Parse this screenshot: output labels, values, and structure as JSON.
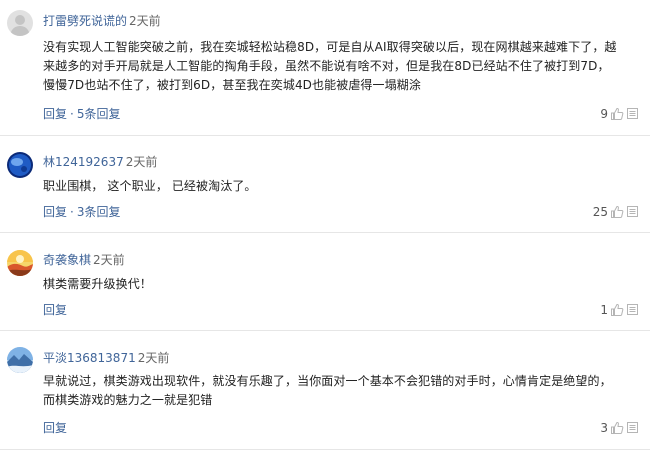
{
  "comments": [
    {
      "username": "打雷劈死说谎的",
      "time": "2天前",
      "text": "没有实现人工智能突破之前，我在奕城轻松站稳8D，可是自从AI取得突破以后，现在网棋越来越难下了，越来越多的对手开局就是人工智能的掏角手段，虽然不能说有啥不对，但是我在8D已经站不住了被打到7D，慢慢7D也站不住了，被打到6D，甚至我在奕城4D也能被虐得一塌糊涂",
      "reply_label": "回复",
      "separator": "·",
      "replies_label": "5条回复",
      "likes": "9",
      "avatar": "default-gray-avatar-icon"
    },
    {
      "username": "林124192637",
      "time": "2天前",
      "text": "职业围棋， 这个职业， 已经被淘汰了。",
      "reply_label": "回复",
      "separator": "·",
      "replies_label": "3条回复",
      "likes": "25",
      "avatar": "blue-planet-avatar-icon"
    },
    {
      "username": "奇袭象棋",
      "time": "2天前",
      "text": "棋类需要升级换代！",
      "reply_label": "回复",
      "likes": "1",
      "avatar": "sunset-landscape-avatar-icon"
    },
    {
      "username": "平淡136813871",
      "time": "2天前",
      "text": "早就说过，棋类游戏出现软件，就没有乐趣了，当你面对一个基本不会犯错的对手时，心情肯定是绝望的，而棋类游戏的魅力之一就是犯错",
      "reply_label": "回复",
      "likes": "3",
      "avatar": "blue-landscape-avatar-icon"
    }
  ],
  "colors": {
    "username": "#406599",
    "action_link": "#406599",
    "time": "#666666",
    "divider": "#e6e6e6",
    "icon_gray": "#b5b5b5"
  }
}
